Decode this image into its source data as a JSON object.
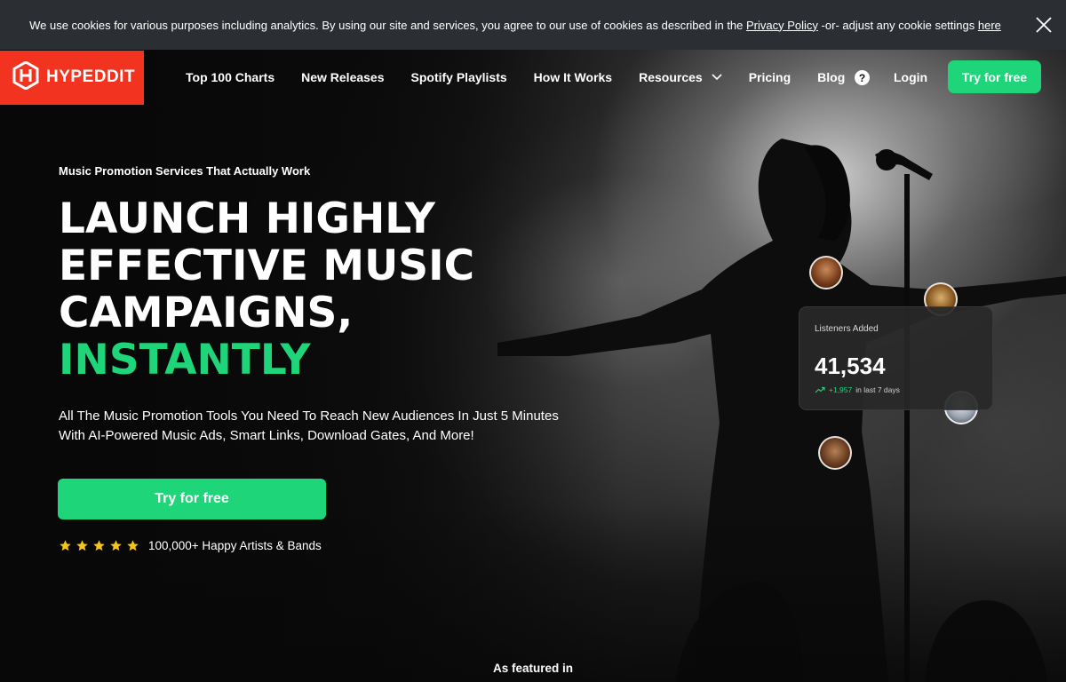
{
  "cookie": {
    "text_before": "We use cookies for various purposes including analytics. By using our site and services, you agree to our use of cookies as described in the ",
    "privacy_link": "Privacy Policy",
    "text_middle": " -or- adjust any cookie settings ",
    "here_link": "here"
  },
  "brand": {
    "name": "HYPEDDIT",
    "color": "#f2331f"
  },
  "nav": {
    "links": [
      "Top 100 Charts",
      "New Releases",
      "Spotify Playlists",
      "How It Works",
      "Resources",
      "Pricing",
      "Blog"
    ],
    "help": "?",
    "login": "Login",
    "cta": "Try for free"
  },
  "hero": {
    "eyebrow": "Music Promotion Services That Actually Work",
    "headline_lines": [
      "LAUNCH HIGHLY",
      "EFFECTIVE MUSIC",
      "CAMPAIGNS,"
    ],
    "headline_accent": "INSTANTLY",
    "subtext_line1": "All The Music Promotion Tools You Need To Reach New Audiences In Just 5 Minutes",
    "subtext_line2": "With AI-Powered Music Ads, Smart Links, Download Gates, And More!",
    "cta": "Try for free",
    "rating_stars": 5,
    "rating_text": "100,000+ Happy Artists & Bands"
  },
  "stats_card": {
    "label": "Listeners Added",
    "value": "41,534",
    "trend_value": "+1,957",
    "trend_text": "in last 7 days"
  },
  "featured": "As featured in",
  "colors": {
    "accent": "#1fd57a",
    "star": "#f5c518",
    "cookie_bg": "#2b2f33"
  }
}
